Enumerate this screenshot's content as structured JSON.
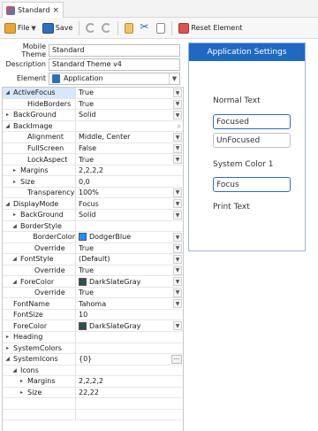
{
  "tab": {
    "title": "Standard",
    "close": "×"
  },
  "toolbar": {
    "file_label": "File",
    "save_label": "Save",
    "reset_label": "Reset Element"
  },
  "fields": {
    "mobile_theme_label": "Mobile Theme",
    "mobile_theme_value": "Standard",
    "description_label": "Description",
    "description_value": "Standard Theme v4",
    "element_label": "Element",
    "element_value": "Application"
  },
  "grid_rows": [
    {
      "name": "ActiveFocus",
      "value": "True",
      "indent": 0,
      "glyph": "◢",
      "selected": true,
      "dropdown": true
    },
    {
      "name": "HideBorders",
      "value": "True",
      "indent": 2,
      "glyph": "",
      "dropdown": true
    },
    {
      "name": "BackGround",
      "value": "Solid",
      "indent": 0,
      "glyph": "▸",
      "dropdown": true
    },
    {
      "name": "BackImage",
      "value": "",
      "indent": 0,
      "glyph": "◢",
      "search": true
    },
    {
      "name": "Alignment",
      "value": "Middle, Center",
      "indent": 2,
      "glyph": "",
      "dropdown": true
    },
    {
      "name": "FullScreen",
      "value": "False",
      "indent": 2,
      "glyph": "",
      "dropdown": true
    },
    {
      "name": "LockAspect",
      "value": "True",
      "indent": 2,
      "glyph": "",
      "dropdown": true
    },
    {
      "name": "Margins",
      "value": "2,2,2,2",
      "indent": 1,
      "glyph": "▸"
    },
    {
      "name": "Size",
      "value": "0,0",
      "indent": 1,
      "glyph": "▸"
    },
    {
      "name": "Transparency",
      "value": "100%",
      "indent": 2,
      "glyph": "",
      "dropdown": true
    },
    {
      "name": "DisplayMode",
      "value": "Focus",
      "indent": 0,
      "glyph": "◢",
      "dropdown": true
    },
    {
      "name": "BackGround",
      "value": "Solid",
      "indent": 1,
      "glyph": "▸",
      "dropdown": true
    },
    {
      "name": "BorderStyle",
      "value": "",
      "indent": 1,
      "glyph": "◢"
    },
    {
      "name": "BorderColor",
      "value": "DodgerBlue",
      "indent": 3,
      "glyph": "",
      "swatch": "#1e90ff",
      "dropdown": true
    },
    {
      "name": "Override",
      "value": "True",
      "indent": 3,
      "glyph": "",
      "dropdown": true
    },
    {
      "name": "FontStyle",
      "value": "(Default)",
      "indent": 1,
      "glyph": "◢",
      "dropdown": true
    },
    {
      "name": "Override",
      "value": "True",
      "indent": 3,
      "glyph": "",
      "dropdown": true
    },
    {
      "name": "ForeColor",
      "value": "DarkSlateGray",
      "indent": 1,
      "glyph": "◢",
      "swatch": "#2f4f4f",
      "dropdown": true
    },
    {
      "name": "Override",
      "value": "True",
      "indent": 3,
      "glyph": "",
      "dropdown": true
    },
    {
      "name": "FontName",
      "value": "Tahoma",
      "indent": 0,
      "glyph": "",
      "dropdown": true
    },
    {
      "name": "FontSize",
      "value": "10",
      "indent": 0,
      "glyph": ""
    },
    {
      "name": "ForeColor",
      "value": "DarkSlateGray",
      "indent": 0,
      "glyph": "",
      "swatch": "#2f4f4f",
      "dropdown": true
    },
    {
      "name": "Heading",
      "value": "",
      "indent": 0,
      "glyph": "▸"
    },
    {
      "name": "SystemColors",
      "value": "",
      "indent": 0,
      "glyph": "▸"
    },
    {
      "name": "SystemIcons",
      "value": "{0}",
      "indent": 0,
      "glyph": "◢",
      "ellipsis": true
    },
    {
      "name": "Icons",
      "value": "",
      "indent": 1,
      "glyph": "◢"
    },
    {
      "name": "Margins",
      "value": "2,2,2,2",
      "indent": 2,
      "glyph": "▸"
    },
    {
      "name": "Size",
      "value": "22,22",
      "indent": 2,
      "glyph": "▸"
    },
    {
      "name": "",
      "value": "",
      "indent": 0,
      "glyph": ""
    },
    {
      "name": "",
      "value": "",
      "indent": 0,
      "glyph": ""
    }
  ],
  "preview": {
    "title": "Application Settings",
    "normal_text": "Normal Text",
    "focused": "Focused",
    "unfocused": "UnFocused",
    "system_color": "System Color 1",
    "focus": "Focus",
    "print_text": "Print Text"
  },
  "colors": {
    "accent": "#1e69c2",
    "selection": "#d7e8fa",
    "dodger_blue": "#1e90ff",
    "dark_slate_gray": "#2f4f4f"
  }
}
